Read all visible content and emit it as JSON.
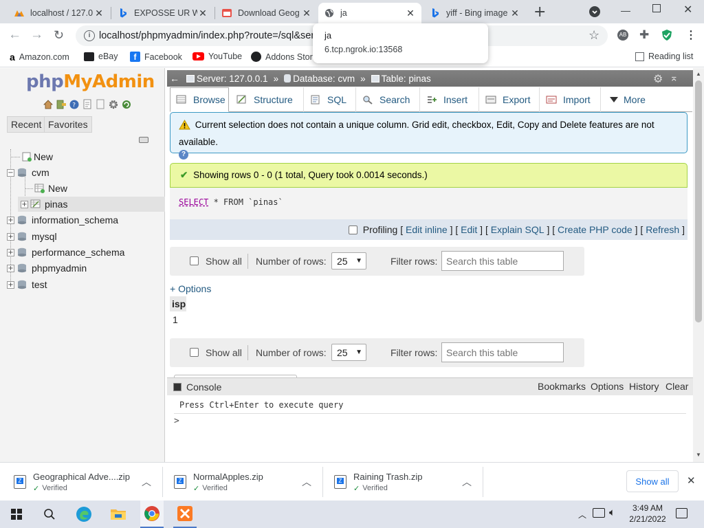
{
  "browser": {
    "tabs": [
      {
        "title": "localhost / 127.0",
        "icon": "phpmyadmin-favicon",
        "active": false
      },
      {
        "title": "EXPOSSE UR WE",
        "icon": "bing-favicon",
        "active": false
      },
      {
        "title": "Download Geog",
        "icon": "download-site-favicon",
        "active": false
      },
      {
        "title": "ja",
        "icon": "globe-favicon",
        "active": true
      },
      {
        "title": "yiff - Bing image",
        "icon": "bing-favicon",
        "active": false
      }
    ],
    "url": "localhost/phpmyadmin/index.php?route=/sql&ser",
    "tooltip": {
      "title": "ja",
      "subtitle": "6.tcp.ngrok.io:13568"
    },
    "bookmarks": [
      "Amazon.com",
      "eBay",
      "Facebook",
      "YouTube",
      "Addons Stor"
    ],
    "reading_list": "Reading list"
  },
  "pma": {
    "logo_php": "php",
    "logo_myadmin": "MyAdmin",
    "nav_buttons": [
      "Recent",
      "Favorites"
    ],
    "tree": [
      {
        "label": "New",
        "level": 1
      },
      {
        "label": "cvm",
        "level": 0
      },
      {
        "label": "New",
        "level": 2
      },
      {
        "label": "pinas",
        "level": 1
      },
      {
        "label": "information_schema",
        "level": 0
      },
      {
        "label": "mysql",
        "level": 0
      },
      {
        "label": "performance_schema",
        "level": 0
      },
      {
        "label": "phpmyadmin",
        "level": 0
      },
      {
        "label": "test",
        "level": 0
      }
    ],
    "breadcrumb": {
      "server": "Server: 127.0.0.1",
      "database": "Database: cvm",
      "table": "Table: pinas",
      "sep": "»"
    },
    "tabs": [
      "Browse",
      "Structure",
      "SQL",
      "Search",
      "Insert",
      "Export",
      "Import",
      "More"
    ],
    "notice": "Current selection does not contain a unique column. Grid edit, checkbox, Edit, Copy and Delete features are not available.",
    "success": "Showing rows 0 - 0 (1 total, Query took 0.0014 seconds.)",
    "query": {
      "keyword_select": "SELECT",
      "rest": " * FROM `pinas`"
    },
    "sql_options": {
      "profiling": "Profiling",
      "links": [
        "Edit inline",
        "Edit",
        "Explain SQL",
        "Create PHP code",
        "Refresh"
      ]
    },
    "filter": {
      "show_all": "Show all",
      "num_rows_label": "Number of rows:",
      "num_rows_value": "25",
      "filter_label": "Filter rows:",
      "search_placeholder": "Search this table"
    },
    "options_link": "+ Options",
    "results": {
      "columns": [
        "isp"
      ],
      "rows": [
        [
          "1"
        ]
      ]
    },
    "console": {
      "title": "Console",
      "actions": [
        "Bookmarks",
        "Options",
        "History",
        "Clear"
      ],
      "hint": "Press Ctrl+Enter to execute query",
      "prompt": ">"
    }
  },
  "downloads": {
    "items": [
      {
        "name": "Geographical Adve....zip",
        "status": "Verified"
      },
      {
        "name": "NormalApples.zip",
        "status": "Verified"
      },
      {
        "name": "Raining Trash.zip",
        "status": "Verified"
      }
    ],
    "show_all": "Show all"
  },
  "taskbar": {
    "time": "3:49 AM",
    "date": "2/21/2022"
  }
}
